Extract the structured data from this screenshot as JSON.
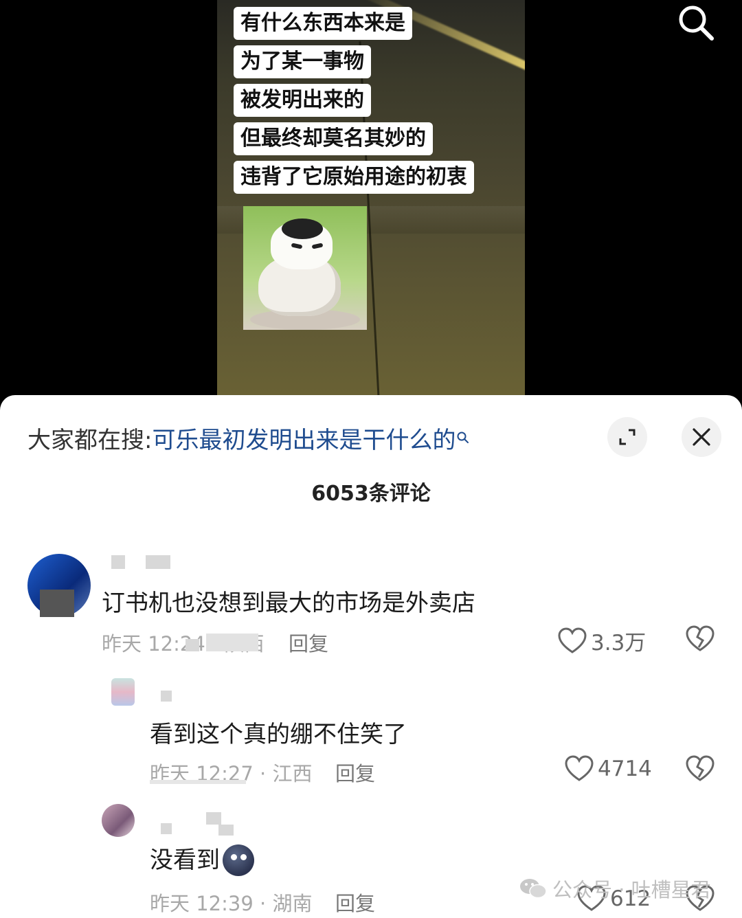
{
  "video": {
    "captions": [
      "有什么东西本来是",
      "为了某一事物",
      "被发明出来的",
      "但最终却莫名其妙的",
      "违背了它原始用途的初衷"
    ]
  },
  "panel": {
    "hot_search_prefix": "大家都在搜:",
    "hot_search_query": "可乐最初发明出来是干什么的",
    "comment_count": "6053条评论"
  },
  "comments": [
    {
      "username": "",
      "text": "订书机也没想到最大的市场是外卖店",
      "time_location": "昨天 12:24 · 陕西",
      "reply_label": "回复",
      "likes": "3.3万"
    },
    {
      "username": "",
      "text": "看到这个真的绷不住笑了",
      "time_location": "昨天 12:27 · 江西",
      "reply_label": "回复",
      "likes": "4714"
    },
    {
      "username": "",
      "text": "没看到",
      "time_location": "昨天 12:39 · 湖南",
      "reply_label": "回复",
      "likes": "612"
    }
  ],
  "watermark": "公众号 · 吐槽星君",
  "colors": {
    "link_blue": "#1f4c8f",
    "meta_gray": "#a8a8a8"
  }
}
